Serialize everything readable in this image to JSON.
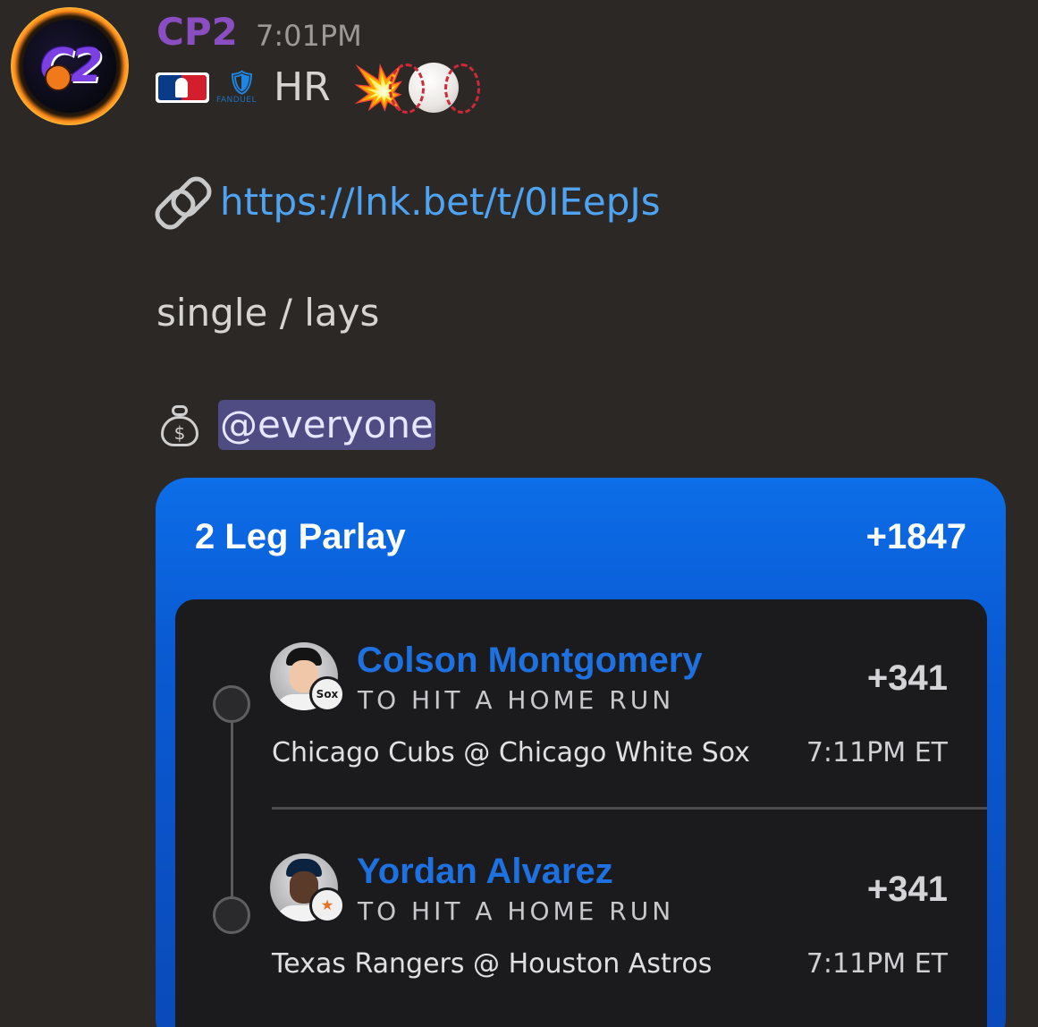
{
  "message": {
    "username": "CP2",
    "timestamp": "7:01PM",
    "avatar_text": "C2",
    "line1": {
      "icons": [
        "mlb-logo",
        "fanduel-logo"
      ],
      "fanduel_caption": "FANDUEL",
      "text": "HR",
      "emoji_collision": "💥",
      "emoji_baseball": "baseball"
    },
    "link": {
      "icon": "link-icon",
      "url": "https://lnk.bet/t/0IEepJs"
    },
    "text": "single / lays",
    "mention": {
      "icon": "money-bag-icon",
      "bag_symbol": "$",
      "label": "@everyone"
    }
  },
  "parlay": {
    "title": "2 Leg Parlay",
    "odds": "+1847",
    "legs": [
      {
        "player": "Colson Montgomery",
        "bet_type": "TO HIT A HOME RUN",
        "odds": "+341",
        "matchup": "Chicago Cubs @ Chicago White Sox",
        "time": "7:11PM ET",
        "team_badge": "Sox",
        "cap_logo": "♠"
      },
      {
        "player": "Yordan Alvarez",
        "bet_type": "TO HIT A HOME RUN",
        "odds": "+341",
        "matchup": "Texas Rangers @ Houston Astros",
        "time": "7:11PM ET",
        "team_badge": "★",
        "cap_logo": "H"
      }
    ]
  },
  "colors": {
    "background": "#2c2825",
    "username": "#8a4dc2",
    "link": "#4ea3f2",
    "mention_bg": "#4f4c84",
    "card_blue": "#0a5ad3",
    "player_name": "#1e71e0"
  }
}
